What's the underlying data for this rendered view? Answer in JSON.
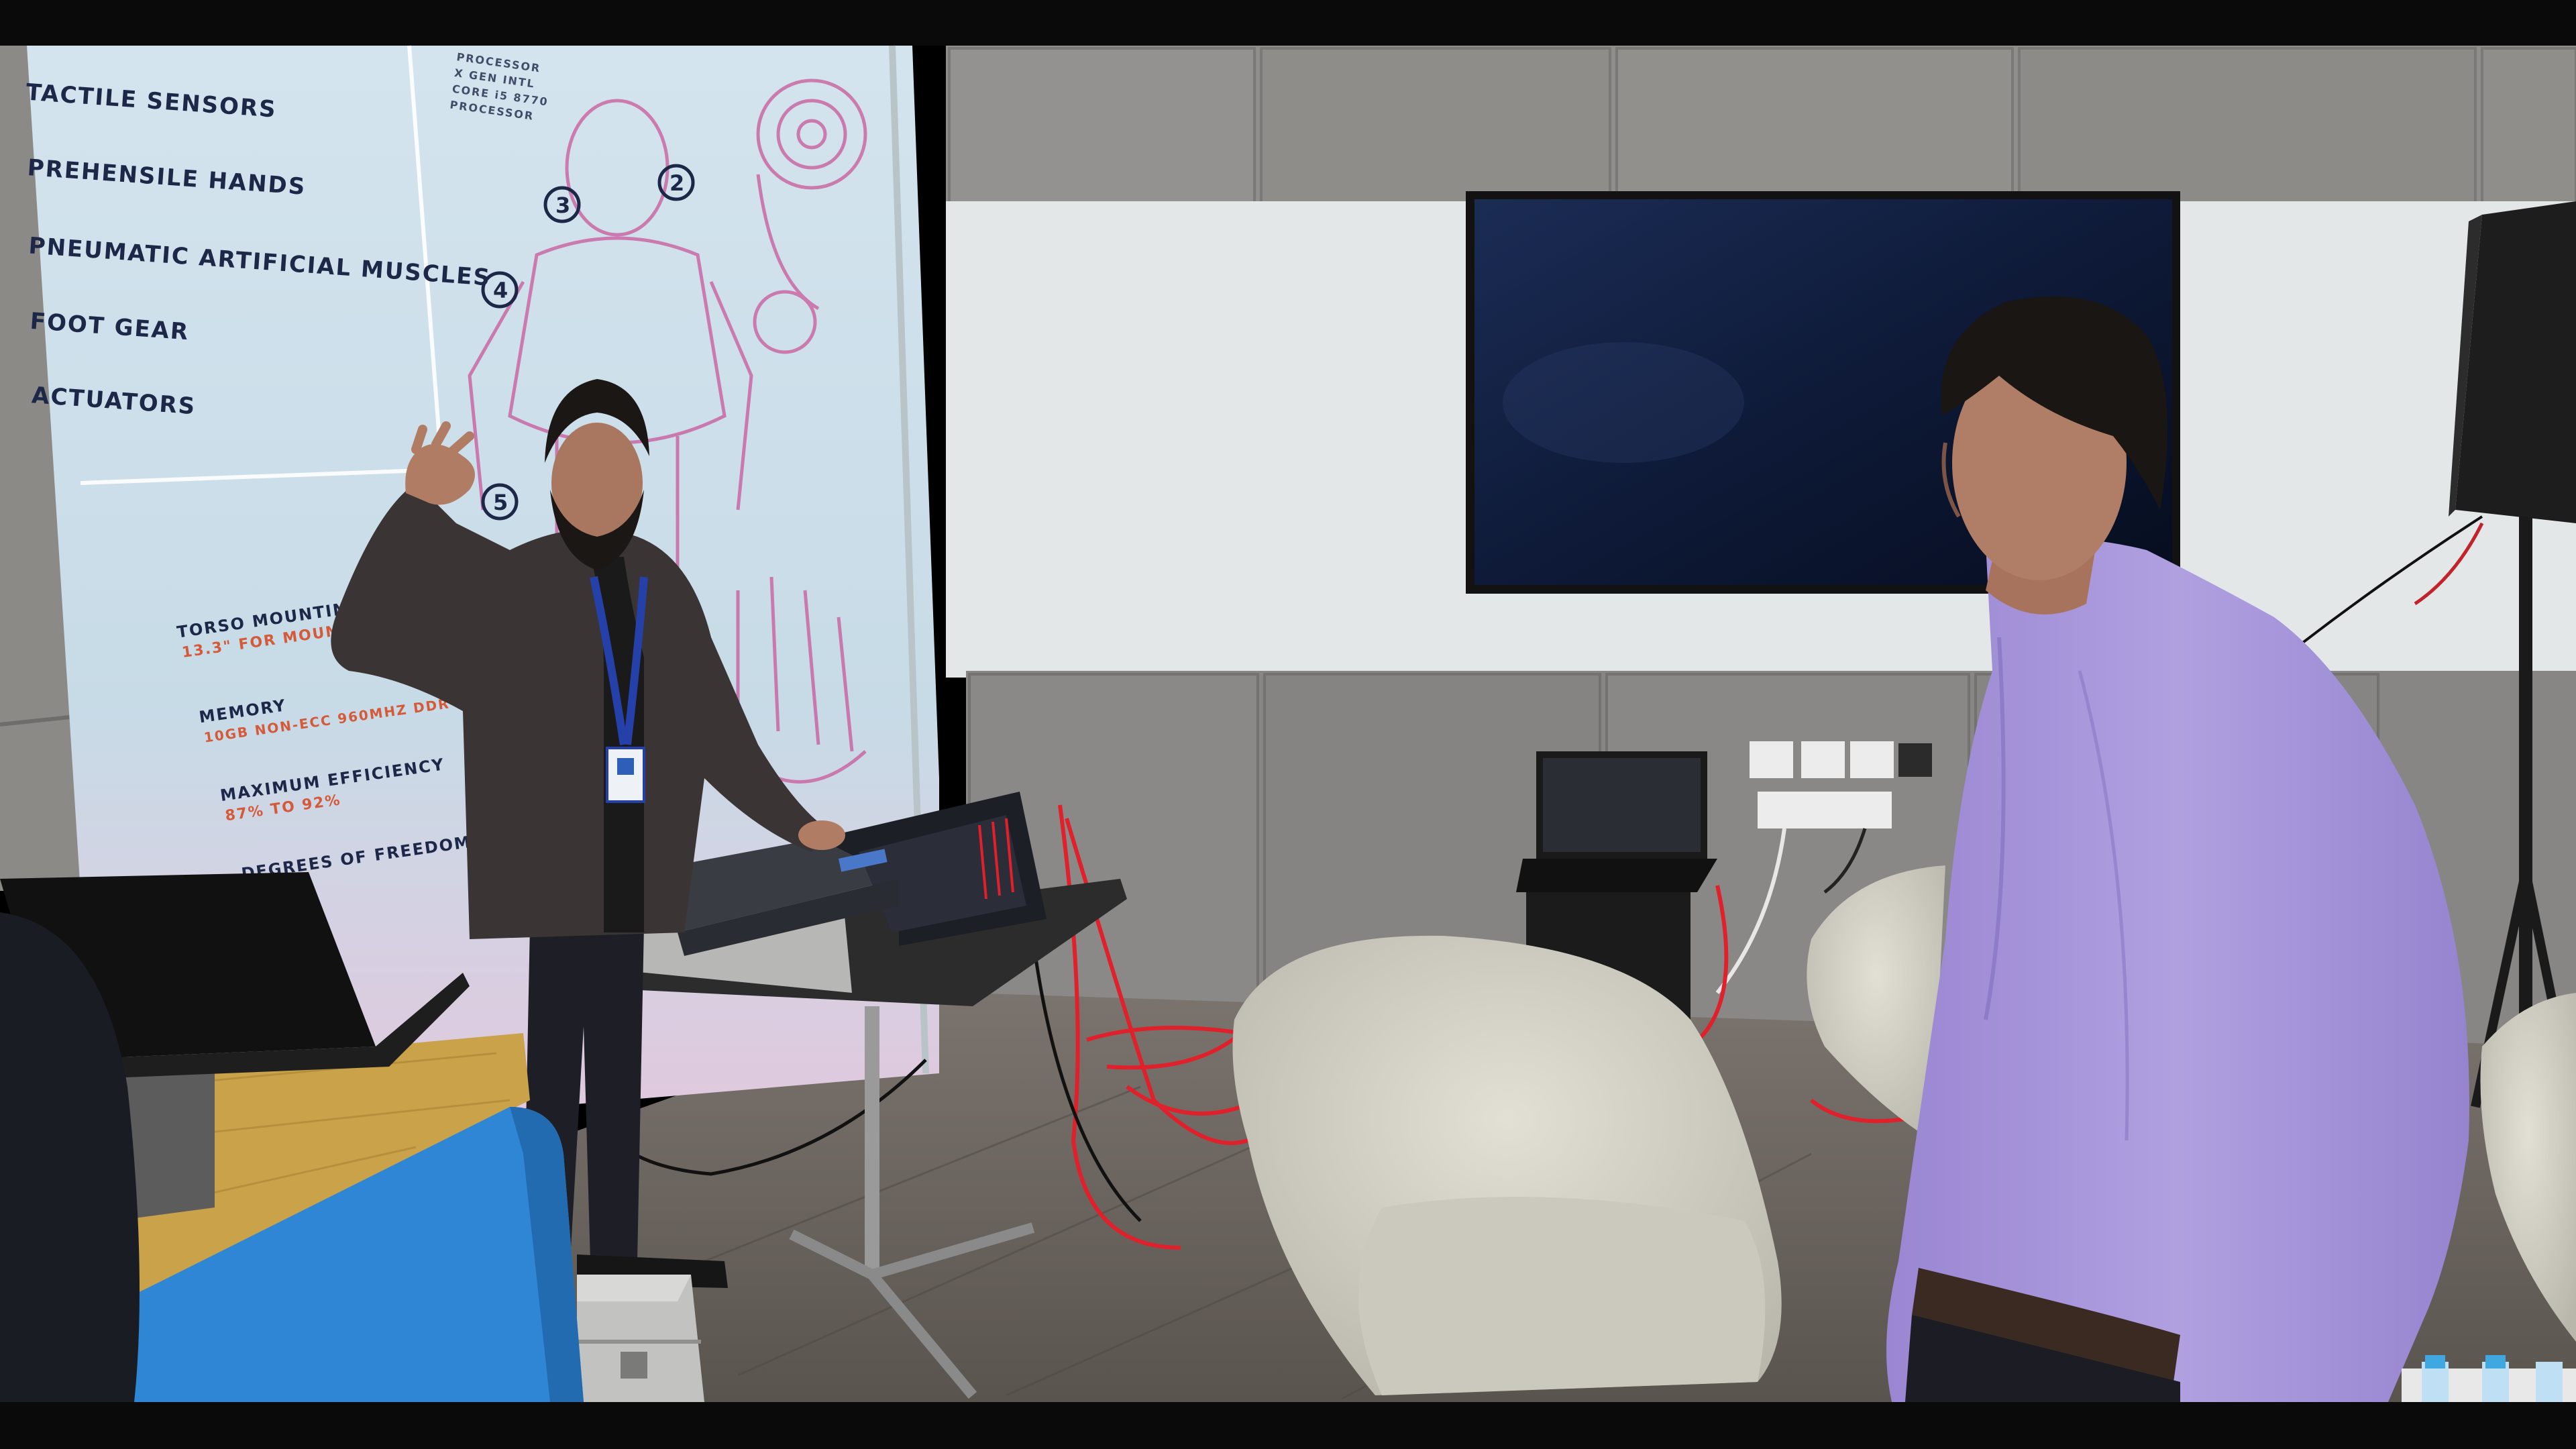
{
  "photo": {
    "wall_panel": {
      "labels": [
        "TACTILE SENSORS",
        "PREHENSILE HANDS",
        "PNEUMATIC ARTIFICIAL MUSCLES",
        "FOOT GEAR",
        "ACTUATORS"
      ],
      "numbers": [
        "2",
        "3",
        "4",
        "5"
      ],
      "spec_titles": [
        "TORSO MOUNTING",
        "MEMORY",
        "MAXIMUM EFFICIENCY",
        "DEGREES OF FREEDOM"
      ],
      "spec_values": [
        "13.3\" FOR MOUN",
        "10GB NON-ECC 960MHZ DDR",
        "87% TO 92%"
      ],
      "processor_text": [
        "PROCESSOR",
        "X GEN INTL",
        "CORE i5 8770",
        "PROCESSOR"
      ]
    },
    "colors": {
      "top_bar": "#0a0a0a",
      "wall_panel": "#c9dbe6",
      "concrete": "#8d8c8a",
      "whiteboard": "#e6e8e9",
      "tv_screen": "#0f1a33",
      "shirt": "#a896d8",
      "jacket": "#3a3434",
      "chair": "#d9d7cb",
      "cable": "#e0202a",
      "floor": "#6d6560",
      "blue_sofa": "#2f86d4"
    }
  }
}
